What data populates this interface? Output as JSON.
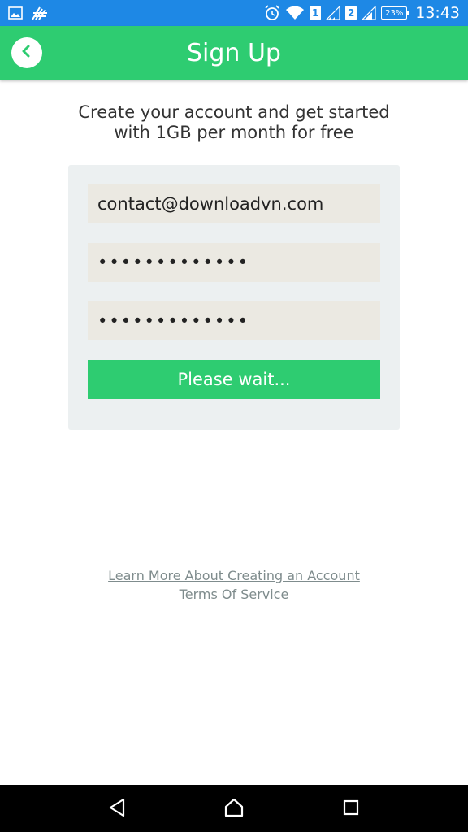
{
  "status_bar": {
    "left_icons": [
      "gallery-icon",
      "app-notification-icon"
    ],
    "sim1": "1",
    "sim2": "2",
    "battery_percent": "23%",
    "time": "13:43"
  },
  "app_bar": {
    "title": "Sign Up",
    "back_icon": "chevron-left-icon",
    "color": "#2ecc71"
  },
  "intro": {
    "line1": "Create your account and get started",
    "line2": "with 1GB per month for free"
  },
  "form": {
    "email_value": "contact@downloadvn.com",
    "password_value": "•••••••••••••",
    "confirm_password_value": "•••••••••••••",
    "submit_label": "Please wait..."
  },
  "links": {
    "learn_more": "Learn More About Creating an Account",
    "terms": "Terms Of Service"
  },
  "nav_bar": {
    "icons": [
      "nav-back-icon",
      "nav-home-icon",
      "nav-recents-icon"
    ]
  }
}
